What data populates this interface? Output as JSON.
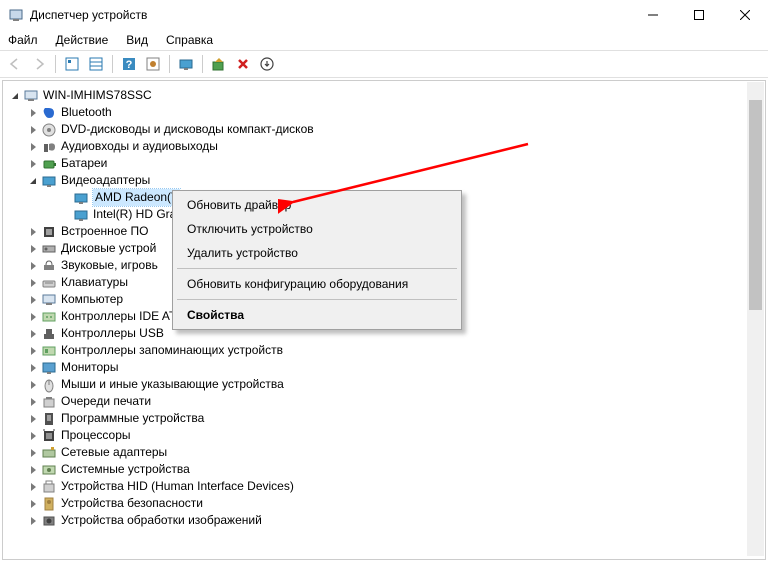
{
  "window": {
    "title": "Диспетчер устройств"
  },
  "menu": {
    "file": "Файл",
    "action": "Действие",
    "view": "Вид",
    "help": "Справка"
  },
  "root": {
    "name": "WIN-IMHIMS78SSC"
  },
  "categories": [
    {
      "label": "Bluetooth"
    },
    {
      "label": "DVD-дисководы и дисководы компакт-дисков"
    },
    {
      "label": "Аудиовходы и аудиовыходы"
    },
    {
      "label": "Батареи"
    },
    {
      "label": "Видеоадаптеры",
      "open": true,
      "children": [
        {
          "label": "AMD Radeon(T",
          "selected": true
        },
        {
          "label": "Intel(R) HD Gra"
        }
      ]
    },
    {
      "label": "Встроенное ПО"
    },
    {
      "label": "Дисковые устрой"
    },
    {
      "label": "Звуковые, игровь"
    },
    {
      "label": "Клавиатуры"
    },
    {
      "label": "Компьютер"
    },
    {
      "label": "Контроллеры IDE ATA/ATAPI"
    },
    {
      "label": "Контроллеры USB"
    },
    {
      "label": "Контроллеры запоминающих устройств"
    },
    {
      "label": "Мониторы"
    },
    {
      "label": "Мыши и иные указывающие устройства"
    },
    {
      "label": "Очереди печати"
    },
    {
      "label": "Программные устройства"
    },
    {
      "label": "Процессоры"
    },
    {
      "label": "Сетевые адаптеры"
    },
    {
      "label": "Системные устройства"
    },
    {
      "label": "Устройства HID (Human Interface Devices)"
    },
    {
      "label": "Устройства безопасности"
    },
    {
      "label": "Устройства обработки изображений"
    }
  ],
  "context_menu": {
    "update": "Обновить драйвер",
    "disable": "Отключить устройство",
    "remove": "Удалить устройство",
    "scan": "Обновить конфигурацию оборудования",
    "props": "Свойства"
  }
}
